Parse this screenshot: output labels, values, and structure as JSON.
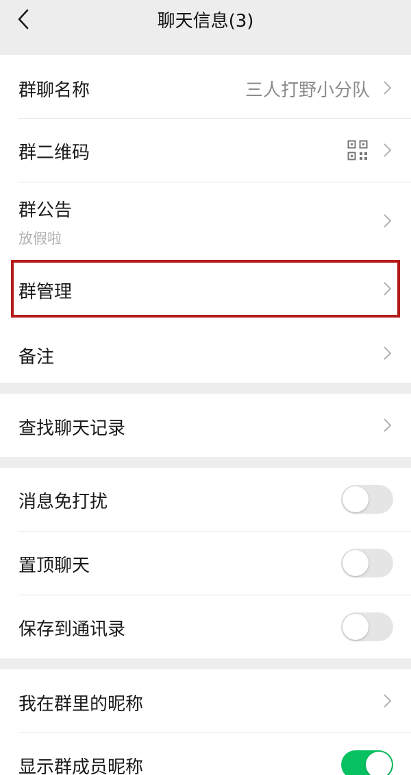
{
  "nav": {
    "title": "聊天信息(3)",
    "back_icon": "chevron-left-icon"
  },
  "group1": {
    "name_label": "群聊名称",
    "name_value": "三人打野小分队",
    "qr_label": "群二维码",
    "notice_label": "群公告",
    "notice_content": "放假啦",
    "manage_label": "群管理",
    "remark_label": "备注"
  },
  "group2": {
    "search_label": "查找聊天记录"
  },
  "group3": {
    "mute_label": "消息免打扰",
    "mute_on": false,
    "pin_label": "置顶聊天",
    "pin_on": false,
    "save_label": "保存到通讯录",
    "save_on": false
  },
  "group4": {
    "nickname_label": "我在群里的昵称",
    "show_names_label": "显示群成员昵称",
    "show_names_on": true
  },
  "colors": {
    "highlight": "#b51c1c",
    "toggle_on": "#07c160",
    "toggle_off": "#e5e5e5"
  }
}
